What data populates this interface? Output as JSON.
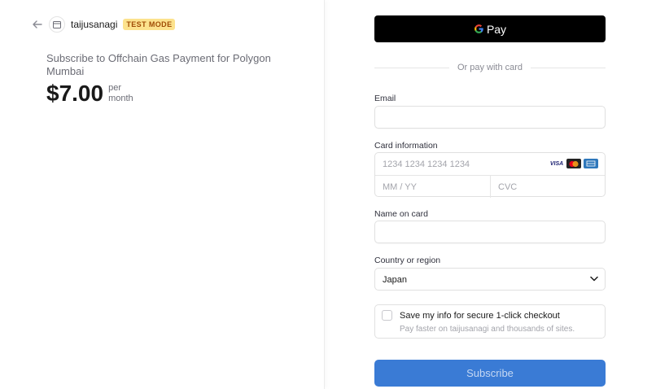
{
  "merchant": {
    "back_icon": "arrow-left-icon",
    "store_icon": "store-icon",
    "name": "taijusanagi",
    "badge": "TEST MODE"
  },
  "product": {
    "title": "Subscribe to Offchain Gas Payment for Polygon Mumbai",
    "price": "$7.00",
    "period_line1": "per",
    "period_line2": "month"
  },
  "payment": {
    "gpay_label": "Pay",
    "divider_text": "Or pay with card",
    "email_label": "Email",
    "email_value": "",
    "card_label": "Card information",
    "card_number_placeholder": "1234 1234 1234 1234",
    "expiry_placeholder": "MM / YY",
    "cvc_placeholder": "CVC",
    "card_brands": [
      "VISA",
      "mastercard-icon",
      "amex-icon"
    ],
    "name_label": "Name on card",
    "name_value": "",
    "country_label": "Country or region",
    "country_value": "Japan",
    "save_title": "Save my info for secure 1-click checkout",
    "save_subtitle": "Pay faster on taijusanagi and thousands of sites.",
    "subscribe_label": "Subscribe"
  },
  "colors": {
    "accent": "#3a7bd5",
    "badge_bg": "#fce28d",
    "badge_text": "#a04c05",
    "gpay_bg": "#000000"
  }
}
